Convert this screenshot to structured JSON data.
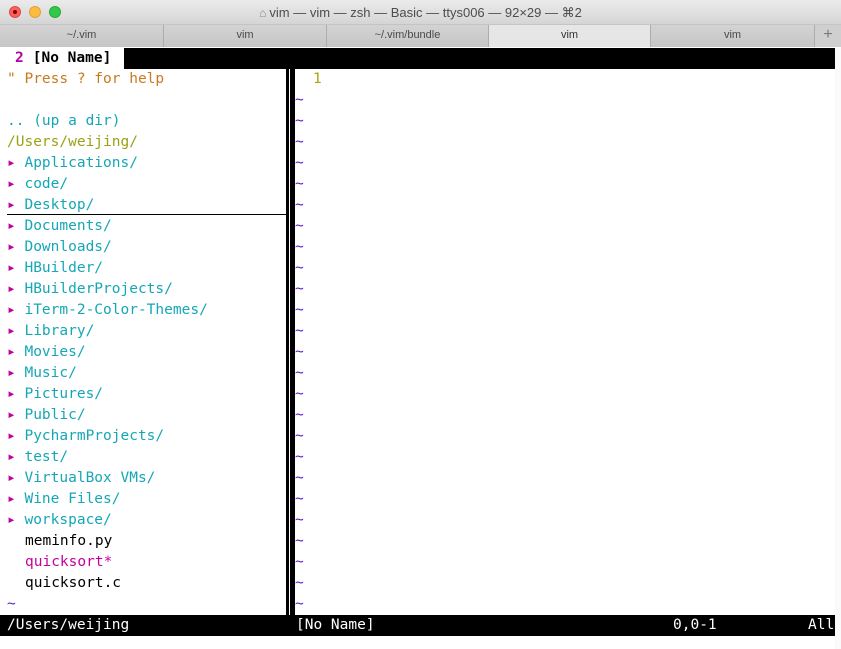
{
  "window": {
    "title": "vim — vim — zsh — Basic — ttys006 — 92×29 — ⌘2",
    "home_icon": "home-icon"
  },
  "tabs": [
    {
      "label": "~/.vim",
      "active": false
    },
    {
      "label": "vim",
      "active": false
    },
    {
      "label": "~/.vim/bundle",
      "active": false
    },
    {
      "label": "vim",
      "active": true
    },
    {
      "label": "vim",
      "active": false
    }
  ],
  "tab_add_label": "+",
  "vim": {
    "tabline": {
      "number": "2",
      "name": "[No Name]"
    },
    "nerdtree": {
      "help": "\" Press ? for help",
      "up_dir": ".. (up a dir)",
      "cwd": "/Users/weijing/",
      "arrow": "▸",
      "dirs": [
        "Applications/",
        "code/",
        "Desktop/",
        "Documents/",
        "Downloads/",
        "HBuilder/",
        "HBuilderProjects/",
        "iTerm-2-Color-Themes/",
        "Library/",
        "Movies/",
        "Music/",
        "Pictures/",
        "Public/",
        "PycharmProjects/",
        "test/",
        "VirtualBox VMs/",
        "Wine Files/",
        "workspace/"
      ],
      "files": [
        {
          "name": "meminfo.py",
          "executable": false
        },
        {
          "name": "quicksort*",
          "executable": true
        },
        {
          "name": "quicksort.c",
          "executable": false
        }
      ],
      "end_tilde": "~"
    },
    "buffer": {
      "line_number": "1",
      "tilde": "~"
    },
    "statusline": {
      "left": "/Users/weijing",
      "buffer_name": "[No Name]",
      "position": "0,0-1",
      "scroll": "All"
    }
  },
  "colors": {
    "help": "#c87a1e",
    "directory": "#15a7b6",
    "cwd": "#9aa214",
    "arrow": "#c4009e",
    "tilde": "#5b20c9",
    "line_number": "#a7a60a"
  }
}
